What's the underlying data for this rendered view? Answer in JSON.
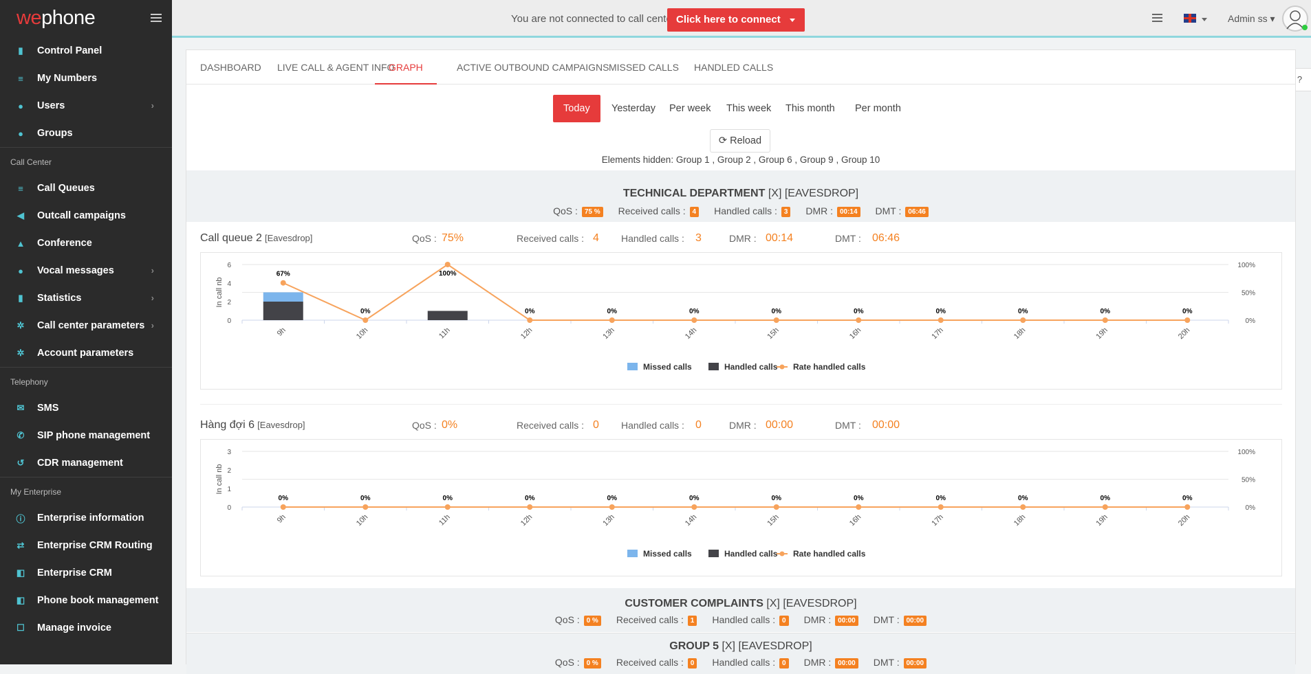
{
  "brand": {
    "logo_part1": "we",
    "logo_part2": "phone"
  },
  "sidebar": {
    "items_main": [
      {
        "label": "Control Panel",
        "icon": "bar-chart-icon",
        "glyph": "▮",
        "chev": false
      },
      {
        "label": "My Numbers",
        "icon": "list-icon",
        "glyph": "≡",
        "chev": false
      },
      {
        "label": "Users",
        "icon": "users-icon",
        "glyph": "●",
        "chev": true
      },
      {
        "label": "Groups",
        "icon": "group-icon",
        "glyph": "●",
        "chev": false
      }
    ],
    "section_call_center": "Call Center",
    "items_cc": [
      {
        "label": "Call Queues",
        "icon": "queue-icon",
        "glyph": "≡",
        "chev": false
      },
      {
        "label": "Outcall campaigns",
        "icon": "volume-icon",
        "glyph": "◀",
        "chev": false
      },
      {
        "label": "Conference",
        "icon": "bank-icon",
        "glyph": "▲",
        "chev": false
      },
      {
        "label": "Vocal messages",
        "icon": "microphone-icon",
        "glyph": "●",
        "chev": true
      },
      {
        "label": "Statistics",
        "icon": "stats-icon",
        "glyph": "▮",
        "chev": true
      },
      {
        "label": "Call center parameters",
        "icon": "cogs-icon",
        "glyph": "✲",
        "chev": true
      },
      {
        "label": "Account parameters",
        "icon": "gear-icon",
        "glyph": "✲",
        "chev": false
      }
    ],
    "section_telephony": "Telephony",
    "items_tel": [
      {
        "label": "SMS",
        "icon": "envelope-icon",
        "glyph": "✉",
        "chev": false
      },
      {
        "label": "SIP phone management",
        "icon": "phone-icon",
        "glyph": "✆",
        "chev": false
      },
      {
        "label": "CDR management",
        "icon": "history-icon",
        "glyph": "↺",
        "chev": false
      }
    ],
    "section_enterprise": "My Enterprise",
    "items_ent": [
      {
        "label": "Enterprise information",
        "icon": "info-icon",
        "glyph": "ⓘ",
        "chev": false
      },
      {
        "label": "Enterprise CRM Routing",
        "icon": "exchange-icon",
        "glyph": "⇄",
        "chev": false
      },
      {
        "label": "Enterprise CRM",
        "icon": "share-icon",
        "glyph": "◧",
        "chev": false
      },
      {
        "label": "Phone book management",
        "icon": "book-icon",
        "glyph": "◧",
        "chev": false
      },
      {
        "label": "Manage invoice",
        "icon": "invoice-icon",
        "glyph": "☐",
        "chev": false
      }
    ]
  },
  "topbar": {
    "not_connected": "You are not connected to call center",
    "connect_button": "Click here to connect",
    "user": "Admin ss"
  },
  "tabs": [
    "DASHBOARD",
    "LIVE CALL & AGENT INFO",
    "GRAPH",
    "ACTIVE OUTBOUND CAMPAIGNS",
    "MISSED CALLS",
    "HANDLED CALLS"
  ],
  "active_tab": "GRAPH",
  "filters": [
    "Today",
    "Yesterday",
    "Per week",
    "This week",
    "This month",
    "Per month"
  ],
  "active_filter": "Today",
  "reload_label": "Reload",
  "elements_hidden": "Elements hidden: Group 1 , Group 2 , Group 6 , Group 9 , Group 10",
  "labels": {
    "qos": "QoS :",
    "received": "Received calls :",
    "handled": "Handled calls :",
    "dmr": "DMR :",
    "dmt": "DMT :"
  },
  "groups": [
    {
      "name": "TECHNICAL DEPARTMENT",
      "suffix": "[X] [EAVESDROP]",
      "qos": "75 %",
      "received": "4",
      "handled": "3",
      "dmr": "00:14",
      "dmt": "06:46"
    },
    {
      "name": "CUSTOMER COMPLAINTS",
      "suffix": "[X] [EAVESDROP]",
      "qos": "0 %",
      "received": "1",
      "handled": "0",
      "dmr": "00:00",
      "dmt": "00:00"
    },
    {
      "name": "GROUP 5",
      "suffix": "[X] [EAVESDROP]",
      "qos": "0 %",
      "received": "0",
      "handled": "0",
      "dmr": "00:00",
      "dmt": "00:00"
    }
  ],
  "queues": [
    {
      "name": "Call queue 2",
      "tag": "[Eavesdrop]",
      "qos": "75%",
      "received": "4",
      "handled": "3",
      "dmr": "00:14",
      "dmt": "06:46"
    },
    {
      "name": "Hàng đợi 6",
      "tag": "[Eavesdrop]",
      "qos": "0%",
      "received": "0",
      "handled": "0",
      "dmr": "00:00",
      "dmt": "00:00"
    }
  ],
  "legend": {
    "missed": "Missed calls",
    "handled": "Handled calls",
    "rate": "Rate handled calls"
  },
  "colors": {
    "accent": "#e63b3b",
    "badge": "#f48121",
    "missed": "#7cb5ec",
    "handled": "#434348",
    "rate": "#f7a35c",
    "sidebar": "#2b2b2b"
  },
  "chart_data": [
    {
      "type": "bar",
      "categories": [
        "9h",
        "10h",
        "11h",
        "12h",
        "13h",
        "14h",
        "15h",
        "16h",
        "17h",
        "18h",
        "19h",
        "20h"
      ],
      "series": [
        {
          "name": "Missed calls",
          "values": [
            1,
            0,
            0,
            0,
            0,
            0,
            0,
            0,
            0,
            0,
            0,
            0
          ]
        },
        {
          "name": "Handled calls",
          "values": [
            2,
            0,
            1,
            0,
            0,
            0,
            0,
            0,
            0,
            0,
            0,
            0
          ]
        },
        {
          "name": "Rate handled calls",
          "values": [
            67,
            0,
            100,
            0,
            0,
            0,
            0,
            0,
            0,
            0,
            0,
            0
          ]
        }
      ],
      "ylabel": "In call nb",
      "ylim": [
        0,
        6
      ],
      "yticks": [
        0,
        2,
        4,
        6
      ],
      "y2ticks": [
        "0%",
        "50%",
        "100%"
      ],
      "rate_labels": [
        "67%",
        "0%",
        "100%",
        "0%",
        "0%",
        "0%",
        "0%",
        "0%",
        "0%",
        "0%",
        "0%",
        "0%"
      ],
      "legend_position": "bottom"
    },
    {
      "type": "bar",
      "categories": [
        "9h",
        "10h",
        "11h",
        "12h",
        "13h",
        "14h",
        "15h",
        "16h",
        "17h",
        "18h",
        "19h",
        "20h"
      ],
      "series": [
        {
          "name": "Missed calls",
          "values": [
            0,
            0,
            0,
            0,
            0,
            0,
            0,
            0,
            0,
            0,
            0,
            0
          ]
        },
        {
          "name": "Handled calls",
          "values": [
            0,
            0,
            0,
            0,
            0,
            0,
            0,
            0,
            0,
            0,
            0,
            0
          ]
        },
        {
          "name": "Rate handled calls",
          "values": [
            0,
            0,
            0,
            0,
            0,
            0,
            0,
            0,
            0,
            0,
            0,
            0
          ]
        }
      ],
      "ylabel": "In call nb",
      "ylim": [
        0,
        3
      ],
      "yticks": [
        0,
        1,
        2,
        3
      ],
      "y2ticks": [
        "0%",
        "50%",
        "100%"
      ],
      "rate_labels": [
        "0%",
        "0%",
        "0%",
        "0%",
        "0%",
        "0%",
        "0%",
        "0%",
        "0%",
        "0%",
        "0%",
        "0%"
      ],
      "legend_position": "bottom"
    }
  ]
}
